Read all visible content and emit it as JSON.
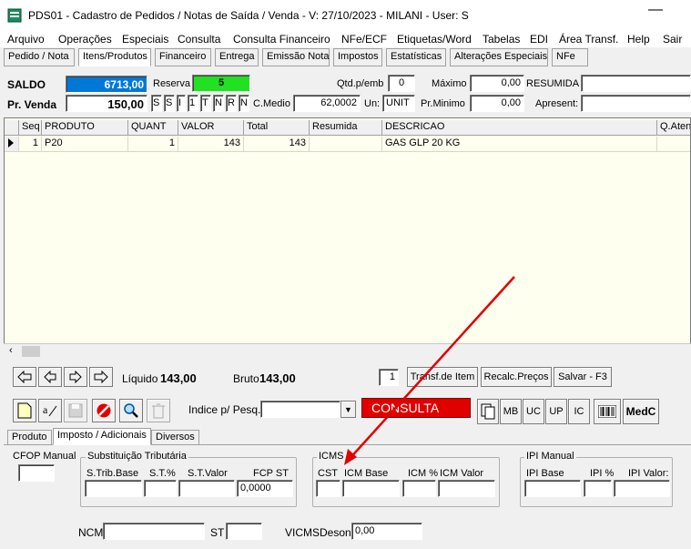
{
  "window": {
    "title": "PDS01 - Cadastro de Pedidos / Notas de Saída / Venda - V: 27/10/2023 - MILANI - User: S"
  },
  "menu": [
    "Arquivo",
    "Operações",
    "Especiais",
    "Consulta",
    "Consulta Financeiro",
    "NFe/ECF",
    "Etiquetas/Word",
    "Tabelas",
    "EDI",
    "Área Transf.",
    "Help",
    "Sair"
  ],
  "top_tabs": [
    "Pedido / Nota",
    "Itens/Produtos",
    "Financeiro",
    "Entrega",
    "Emissão Nota",
    "Impostos",
    "Estatísticas",
    "Alterações Especiais",
    "NFe"
  ],
  "header": {
    "saldo_label": "SALDO",
    "saldo_value": "6713,00",
    "reserva_label": "Reserva",
    "reserva_value": "5",
    "qtd_emb_label": "Qtd.p/emb",
    "qtd_emb_value": "0",
    "maximo_label": "Máximo",
    "maximo_value": "0,00",
    "resumida_label": "RESUMIDA",
    "resumida_value": "",
    "pr_venda_label": "Pr. Venda",
    "pr_venda_value": "150,00",
    "flags": [
      "S",
      "S",
      "I",
      "1",
      "T",
      "N",
      "R",
      "N"
    ],
    "c_medio_label": "C.Medio",
    "c_medio_value": "62,0002",
    "un_label": "Un:",
    "un_value": "UNIT",
    "pr_minimo_label": "Pr.Minimo",
    "pr_minimo_value": "0,00",
    "apresent_label": "Apresent:",
    "apresent_value": ""
  },
  "grid": {
    "columns": [
      "Seq",
      "PRODUTO",
      "QUANT",
      "VALOR",
      "Total",
      "Resumida",
      "DESCRICAO",
      "Q.Atend"
    ],
    "rows": [
      {
        "seq": "1",
        "produto": "P20",
        "quant": "1",
        "valor": "143",
        "total": "143",
        "resumida": "",
        "descricao": "GAS GLP 20 KG",
        "qatend": ""
      }
    ]
  },
  "nav": {
    "liquido_label": "Líquido",
    "liquido_value": "143,00",
    "bruto_label": "Bruto",
    "bruto_value": "143,00",
    "count_value": "1",
    "transf_label": "Transf.de Item",
    "recalc_label": "Recalc.Preços",
    "salvar_label": "Salvar - F3"
  },
  "toolbar": {
    "indice_label": "Indice p/ Pesq.",
    "indice_value": "",
    "status_label": "CONSULTA",
    "buttons": [
      "MB",
      "UC",
      "UP",
      "IC",
      "MedC"
    ]
  },
  "bottom_tabs": [
    "Produto",
    "Imposto / Adicionais",
    "Diversos"
  ],
  "tax": {
    "cfop_label": "CFOP Manual",
    "cfop_value": "",
    "st_group": "Substituição Tributária",
    "st_base_label": "S.Trib.Base",
    "st_pct_label": "S.T.%",
    "st_valor_label": "S.T.Valor",
    "fcp_st_label": "FCP ST",
    "fcp_st_value": "0,0000",
    "icms_group": "ICMS",
    "cst_label": "CST",
    "icm_base_label": "ICM Base",
    "icm_pct_label": "ICM %",
    "icm_valor_label": "ICM Valor",
    "ipi_group": "IPI Manual",
    "ipi_base_label": "IPI Base",
    "ipi_pct_label": "IPI %",
    "ipi_valor_label": "IPI Valor:",
    "ncm_label": "NCM",
    "ncm_value": "",
    "st_label": "ST",
    "st_value": "",
    "vicms_label": "VICMSDeson",
    "vicms_value": "0,00"
  },
  "colors": {
    "saldo_bg": "#0078d7",
    "reserva_bg": "#22e022",
    "status_bg": "#e00000",
    "arrow": "#e00000",
    "grid_bg": "#fffff0"
  }
}
